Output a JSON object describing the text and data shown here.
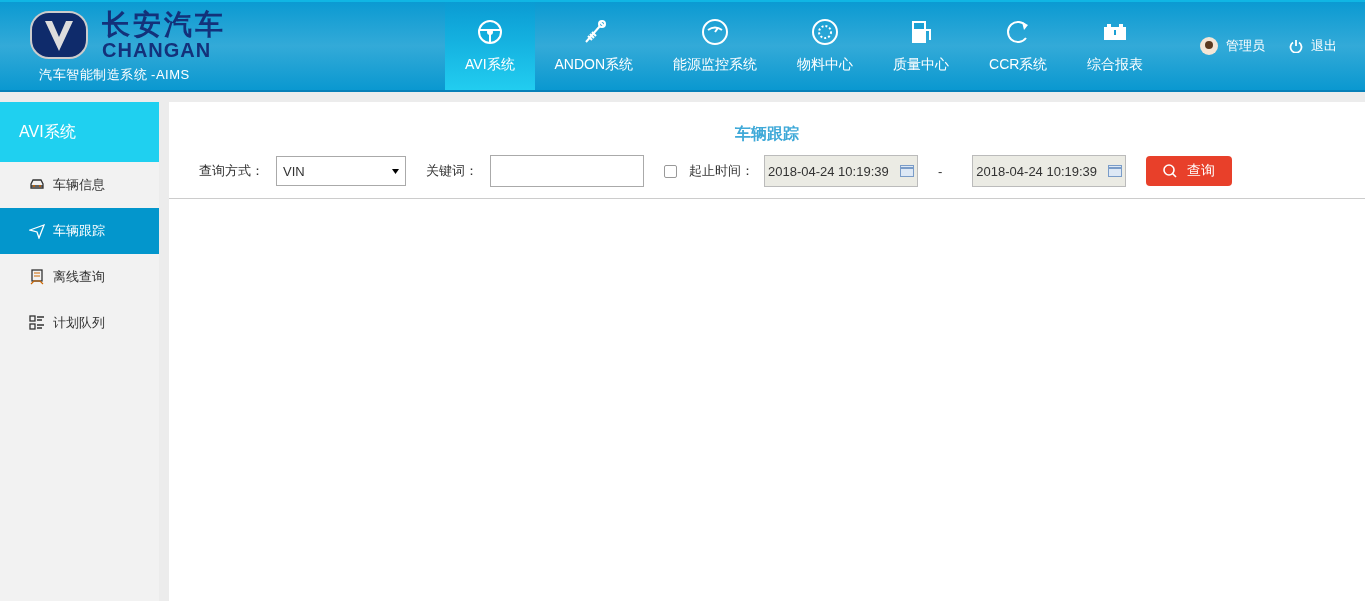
{
  "header": {
    "brand_cn": "长安汽车",
    "brand_en": "CHANGAN",
    "system_name": "汽车智能制造系统 -AIMS"
  },
  "nav": [
    {
      "label": "AVI系统",
      "selected": true
    },
    {
      "label": "ANDON系统",
      "selected": false
    },
    {
      "label": "能源监控系统",
      "selected": false
    },
    {
      "label": "物料中心",
      "selected": false
    },
    {
      "label": "质量中心",
      "selected": false
    },
    {
      "label": "CCR系统",
      "selected": false
    },
    {
      "label": "综合报表",
      "selected": false
    }
  ],
  "user": {
    "name": "管理员",
    "logout": "退出"
  },
  "sidebar": {
    "title": "AVI系统",
    "items": [
      {
        "label": "车辆信息",
        "selected": false
      },
      {
        "label": "车辆跟踪",
        "selected": true
      },
      {
        "label": "离线查询",
        "selected": false
      },
      {
        "label": "计划队列",
        "selected": false
      }
    ]
  },
  "main": {
    "title": "车辆跟踪",
    "query_mode_label": "查询方式：",
    "query_mode": "VIN",
    "keyword_label": "关键词：",
    "time_checkbox": {
      "label": "起止时间：",
      "checked": false
    },
    "start_time": {
      "value": "2018-04-24 10:19:39",
      "disabled": true
    },
    "separator": "-",
    "end_time": {
      "value": "2018-04-24 10:19:39",
      "disabled": true
    },
    "search_button": "查询"
  }
}
